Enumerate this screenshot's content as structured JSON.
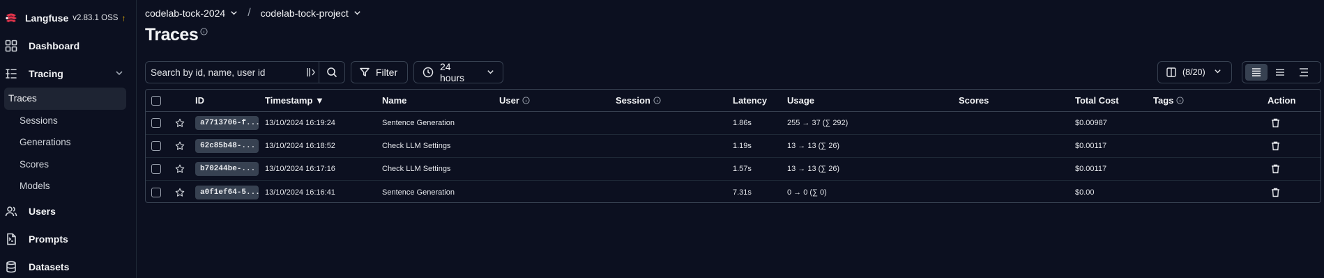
{
  "brand": {
    "name": "Langfuse",
    "version": "v2.83.1 OSS",
    "update_icon": "↑"
  },
  "sidebar": {
    "items": [
      {
        "label": "Dashboard",
        "icon": "grid-icon"
      },
      {
        "label": "Tracing",
        "icon": "tracing-list-icon",
        "expanded": true,
        "children": [
          "Traces",
          "Sessions",
          "Generations",
          "Scores",
          "Models"
        ],
        "active_child": "Traces"
      },
      {
        "label": "Users",
        "icon": "users-icon"
      },
      {
        "label": "Prompts",
        "icon": "prompt-file-icon"
      },
      {
        "label": "Datasets",
        "icon": "database-icon"
      }
    ]
  },
  "breadcrumb": {
    "org": "codelab-tock-2024",
    "separator": "/",
    "project": "codelab-tock-project"
  },
  "page": {
    "title": "Traces"
  },
  "toolbar": {
    "search_placeholder": "Search by id, name, user id",
    "filter_label": "Filter",
    "time_range": "24 hours",
    "columns_label": "(8/20)",
    "density_selected": "comfortable"
  },
  "table": {
    "columns": [
      "ID",
      "Timestamp ▼",
      "Name",
      "User",
      "Session",
      "Latency",
      "Usage",
      "Scores",
      "Total Cost",
      "Tags",
      "Action"
    ],
    "rows": [
      {
        "id": "a7713706-f...",
        "timestamp": "13/10/2024 16:19:24",
        "name": "Sentence Generation",
        "user": "",
        "session": "",
        "latency": "1.86s",
        "usage": "255 → 37 (∑ 292)",
        "scores": "",
        "cost": "$0.00987",
        "tags": ""
      },
      {
        "id": "62c85b48-...",
        "timestamp": "13/10/2024 16:18:52",
        "name": "Check LLM Settings",
        "user": "",
        "session": "",
        "latency": "1.19s",
        "usage": "13 → 13 (∑ 26)",
        "scores": "",
        "cost": "$0.00117",
        "tags": ""
      },
      {
        "id": "b70244be-...",
        "timestamp": "13/10/2024 16:17:16",
        "name": "Check LLM Settings",
        "user": "",
        "session": "",
        "latency": "1.57s",
        "usage": "13 → 13 (∑ 26)",
        "scores": "",
        "cost": "$0.00117",
        "tags": ""
      },
      {
        "id": "a0f1ef64-5...",
        "timestamp": "13/10/2024 16:16:41",
        "name": "Sentence Generation",
        "user": "",
        "session": "",
        "latency": "7.31s",
        "usage": "0 → 0 (∑ 0)",
        "scores": "",
        "cost": "$0.00",
        "tags": ""
      }
    ]
  },
  "colors": {
    "background": "#0c1020",
    "border": "#374151",
    "text": "#e5e7eb",
    "update_accent": "#eab308",
    "logo": "#e0334a"
  }
}
